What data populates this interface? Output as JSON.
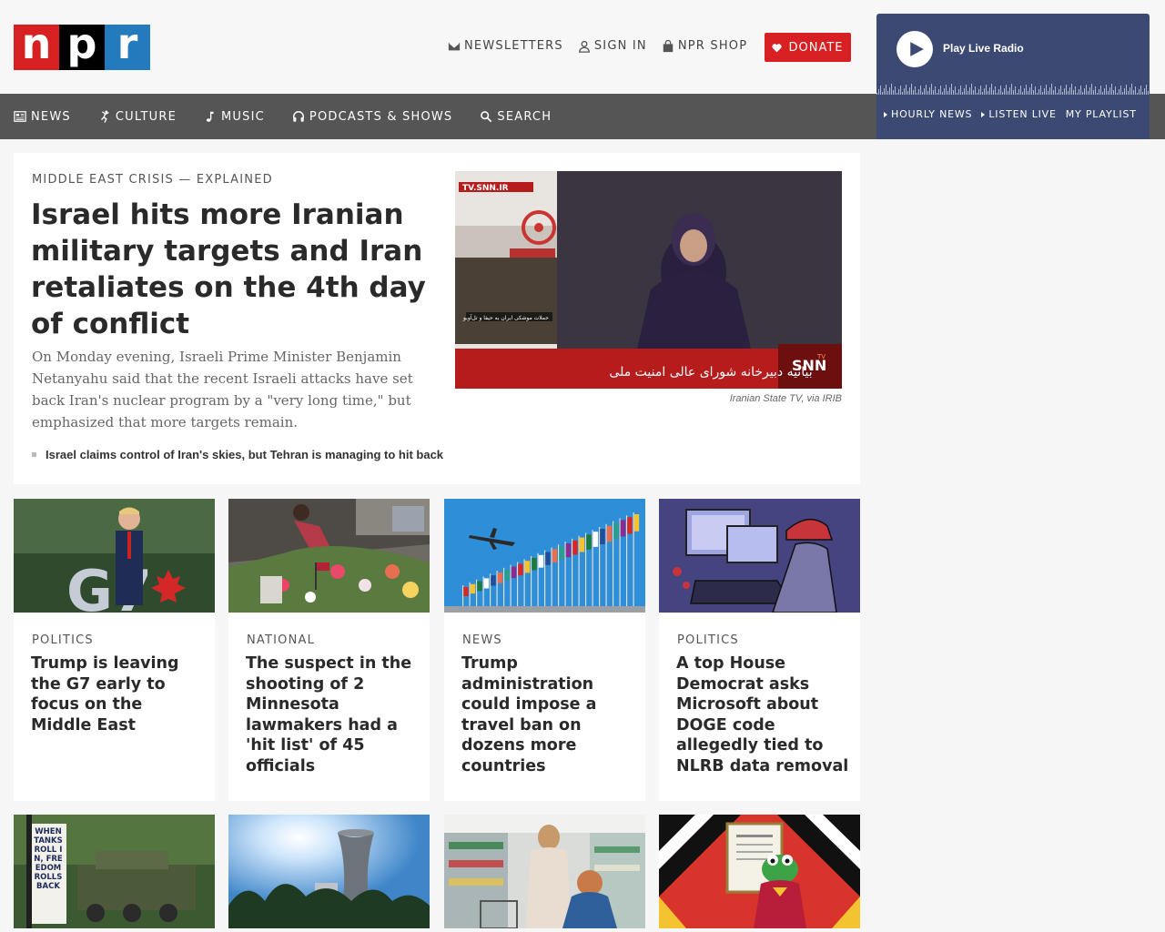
{
  "logo": {
    "letters": [
      "n",
      "p",
      "r"
    ]
  },
  "utility": [
    {
      "label": "NEWSLETTERS",
      "icon": "envelope-icon"
    },
    {
      "label": "SIGN IN",
      "icon": "user-icon"
    },
    {
      "label": "NPR SHOP",
      "icon": "shopping-bag-icon"
    }
  ],
  "donate": {
    "label": "DONATE",
    "icon": "heart-icon"
  },
  "player": {
    "label": "Play Live Radio",
    "links": [
      "HOURLY NEWS",
      "LISTEN LIVE",
      "MY PLAYLIST"
    ]
  },
  "nav": [
    {
      "label": "NEWS",
      "icon": "newspaper-icon"
    },
    {
      "label": "CULTURE",
      "icon": "dancer-icon"
    },
    {
      "label": "MUSIC",
      "icon": "music-note-icon"
    },
    {
      "label": "PODCASTS & SHOWS",
      "icon": "headphones-icon"
    },
    {
      "label": "SEARCH",
      "icon": "search-icon"
    }
  ],
  "featured": {
    "slug": "MIDDLE EAST CRISIS — EXPLAINED",
    "title": "Israel hits more Iranian military targets and Iran retaliates on the 4th day of conflict",
    "teaser": "On Monday evening, Israeli Prime Minister Benjamin Netanyahu said that the recent Israeli attacks have set back Iran's nuclear program by a \"very long time,\" but emphasized that more targets remain.",
    "related": "Israel claims control of Iran's skies, but Tehran is managing to hit back",
    "caption": "Iranian State TV, via IRIB",
    "image_text": {
      "watermark": "TV.SNN.IR",
      "ticker": "بیانیه دبیرخانه شورای عالی امنیت ملی",
      "side_caption": "حملات موشکی ایران به حیفا و تل‌آویو",
      "logo": "SNN",
      "logo_badge": "TV"
    }
  },
  "cards": [
    {
      "slug": "POLITICS",
      "title": "Trump is leaving the G7 early to focus on the Middle East"
    },
    {
      "slug": "NATIONAL",
      "title": "The suspect in the shooting of 2 Minnesota lawmakers had a 'hit list' of 45 officials"
    },
    {
      "slug": "NEWS",
      "title": "Trump administration could impose a travel ban on dozens more countries"
    },
    {
      "slug": "POLITICS",
      "title": "A top House Democrat asks Microsoft about DOGE code allegedly tied to NLRB data removal"
    }
  ],
  "thumb_text": {
    "g7": "G7",
    "sign": "WHEN TANKS ROLL IN, FREEDOM ROLLS BACK"
  }
}
